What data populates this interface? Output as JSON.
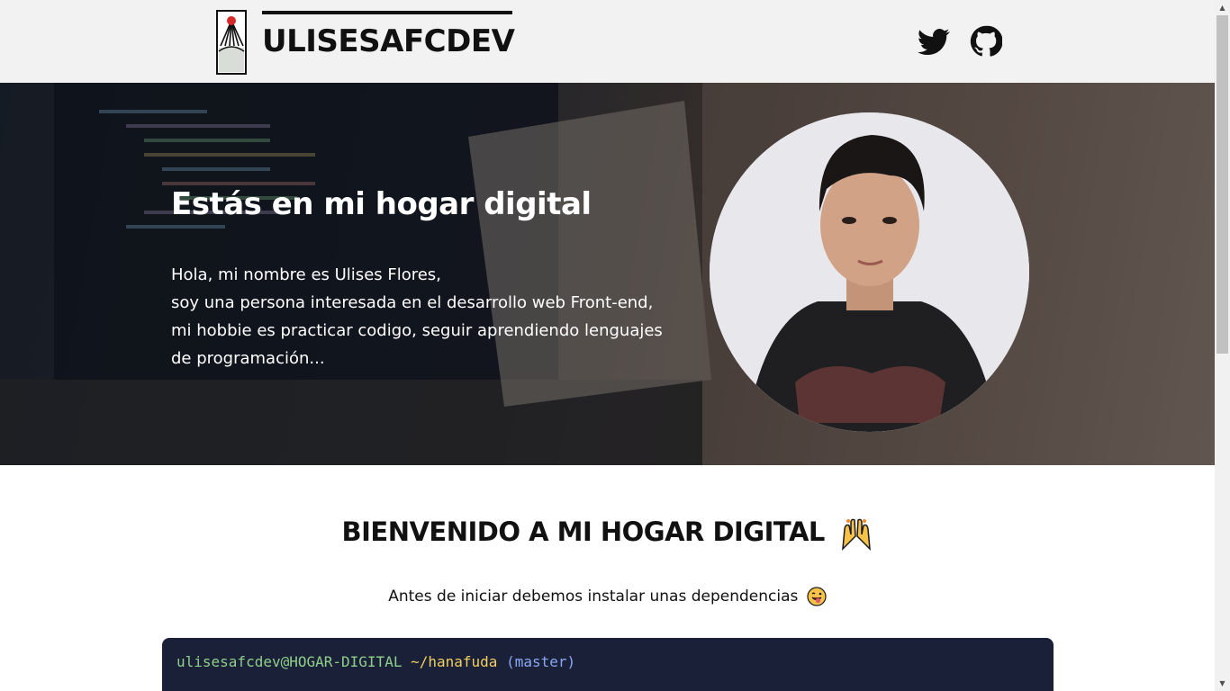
{
  "header": {
    "brand": "ULISESAFCDEV",
    "logo_icon": "hanafuda-card-icon",
    "social": [
      {
        "name": "twitter-icon",
        "label": "Twitter"
      },
      {
        "name": "github-icon",
        "label": "GitHub"
      }
    ]
  },
  "hero": {
    "title": "Estás en mi hogar digital",
    "lines": [
      "Hola, mi nombre es Ulises Flores,",
      "soy una persona interesada en el desarrollo web Front-end,",
      "mi hobbie es practicar codigo, seguir aprendiendo lenguajes",
      "de programación..."
    ]
  },
  "welcome": {
    "title": "BIENVENIDO A MI HOGAR DIGITAL",
    "title_emoji": "raised-hands-emoji",
    "subtitle": "Antes de iniciar debemos instalar unas dependencias",
    "subtitle_emoji": "tongue-wink-emoji"
  },
  "terminal": {
    "user": "ulisesafcdev@HOGAR-DIGITAL",
    "path": "~/hanafuda",
    "branch": "(master)"
  },
  "colors": {
    "header_bg": "#f2f2f2",
    "terminal_bg": "#1a2037",
    "prompt_user": "#8fcf8a",
    "prompt_path": "#f0d060",
    "prompt_branch": "#8aa8f5"
  }
}
